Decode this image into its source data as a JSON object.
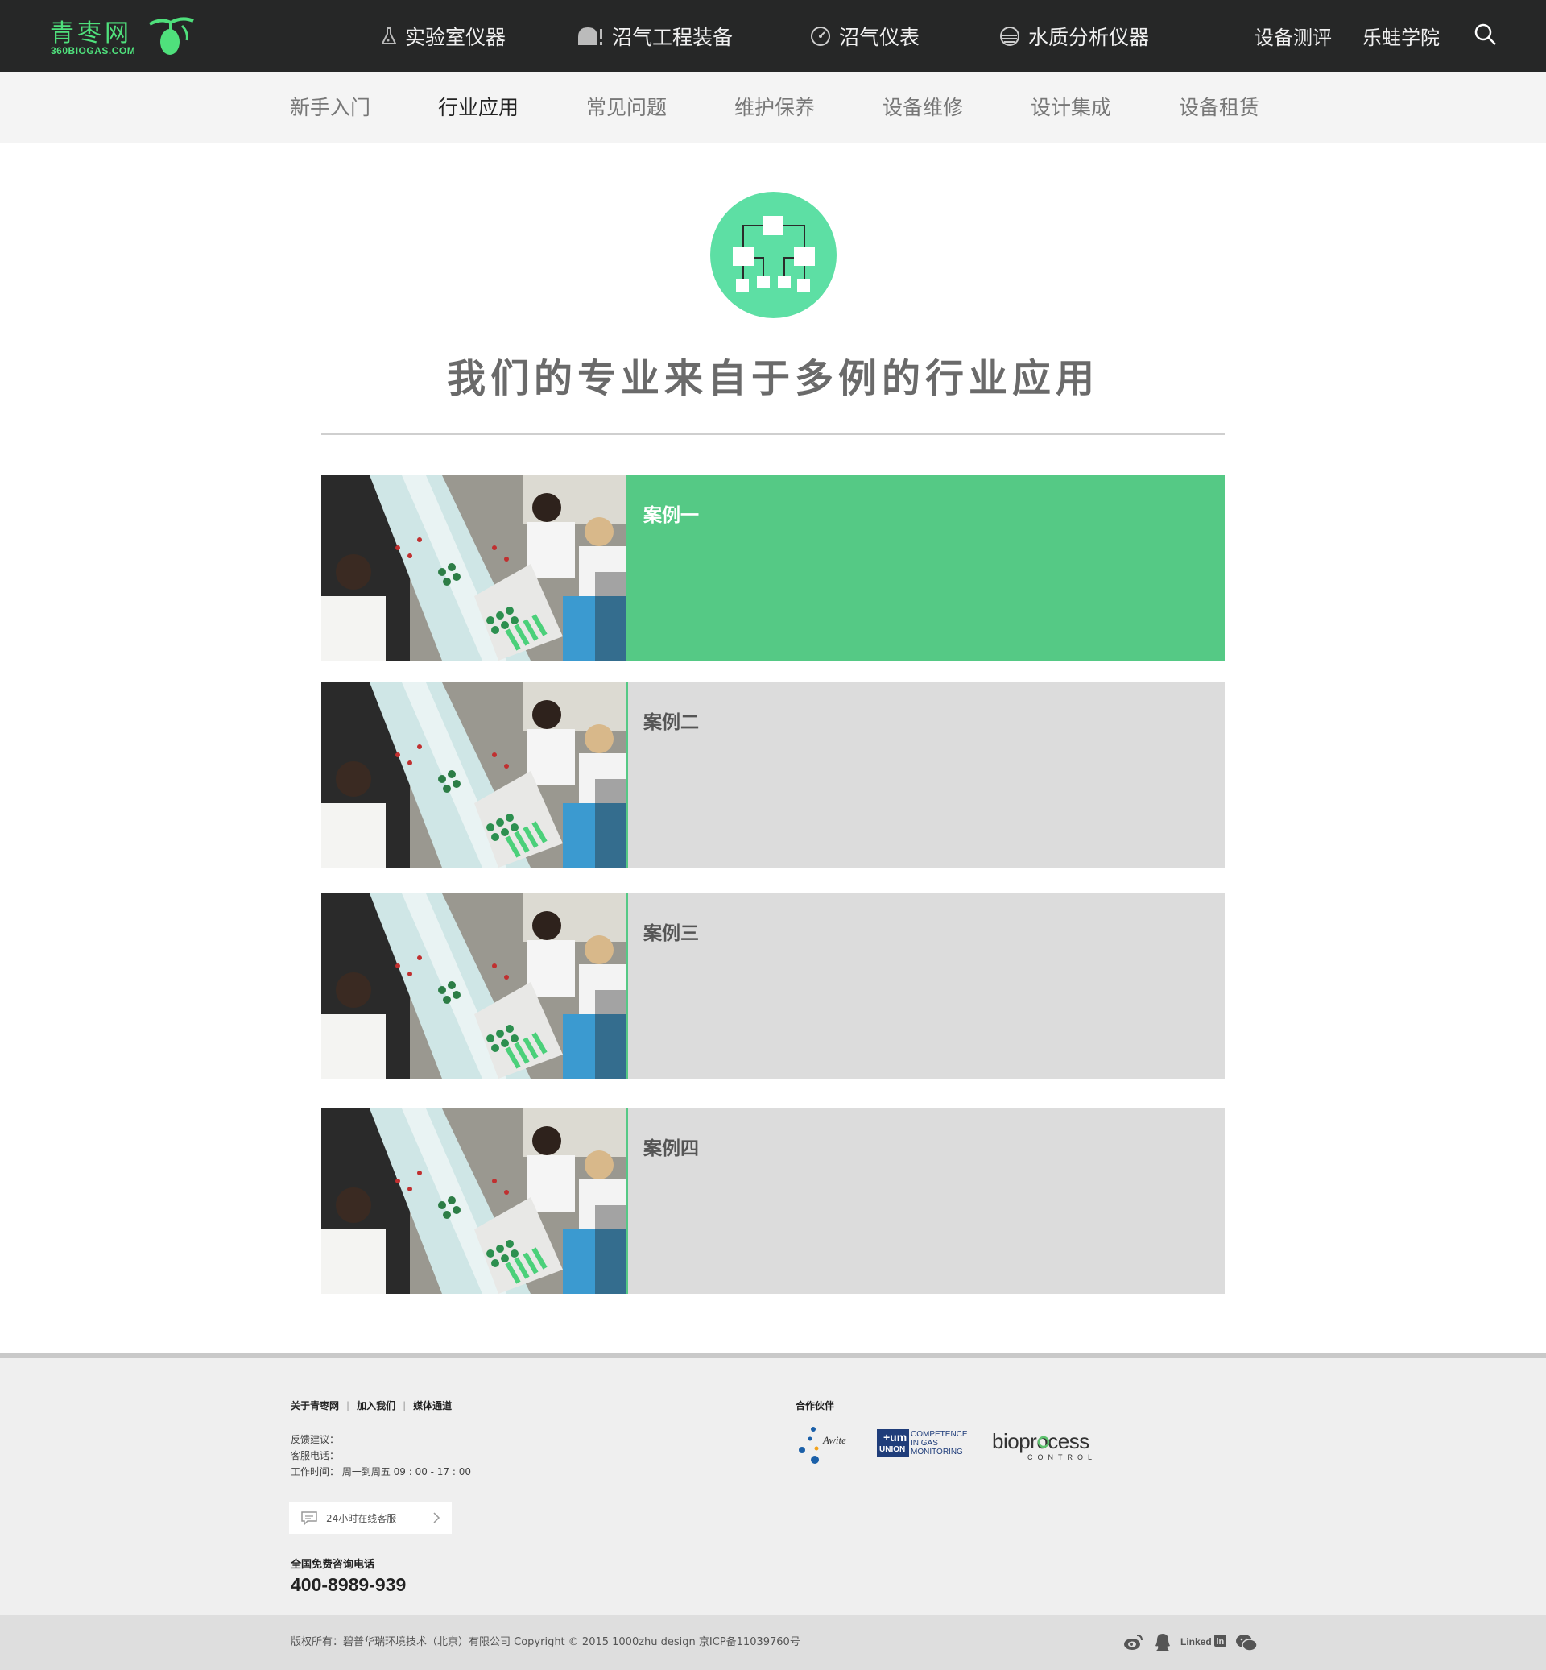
{
  "brand": {
    "name_cn": "青枣网",
    "domain": "360BIOGAS.COM",
    "accent": "#4fe07c"
  },
  "nav": {
    "items": [
      {
        "label": "实验室仪器",
        "icon": "flask-icon"
      },
      {
        "label": "沼气工程装备",
        "icon": "tank-icon"
      },
      {
        "label": "沼气仪表",
        "icon": "gauge-icon"
      },
      {
        "label": "水质分析仪器",
        "icon": "water-icon"
      }
    ],
    "right": [
      {
        "label": "设备测评"
      },
      {
        "label": "乐蛙学院"
      }
    ],
    "search_icon": "search-icon"
  },
  "subnav": {
    "items": [
      {
        "label": "新手入门",
        "active": false
      },
      {
        "label": "行业应用",
        "active": true
      },
      {
        "label": "常见问题",
        "active": false
      },
      {
        "label": "维护保养",
        "active": false
      },
      {
        "label": "设备维修",
        "active": false
      },
      {
        "label": "设计集成",
        "active": false
      },
      {
        "label": "设备租赁",
        "active": false
      }
    ]
  },
  "hero": {
    "icon": "org-chart-icon",
    "title": "我们的专业来自于多例的行业应用",
    "icon_color": "#5ddfa4"
  },
  "cases": [
    {
      "title": "案例一",
      "active": true
    },
    {
      "title": "案例二",
      "active": false
    },
    {
      "title": "案例三",
      "active": false
    },
    {
      "title": "案例四",
      "active": false
    }
  ],
  "footer": {
    "links": [
      "关于青枣网",
      "加入我们",
      "媒体通道"
    ],
    "feedback": "反馈建议：",
    "service_phone": "客服电话：",
    "hours": "工作时间：  周一到周五 09 : 00 - 17 : 00",
    "chat_label": "24小时在线客服",
    "hotline_label": "全国免费咨询电话",
    "hotline": "400-8989-939",
    "partners_label": "合作伙伴",
    "partners": [
      {
        "name": "Awite"
      },
      {
        "name_line1": "COMPETENCE",
        "name_line2": "IN GAS",
        "name_line3": "MONITORING",
        "badge": "UNION"
      },
      {
        "name": "bioprocess",
        "sub": "CONTROL"
      }
    ],
    "copyright": "版权所有：碧普华瑞环境技术（北京）有限公司     Copyright © 2015 1000zhu design 京ICP备11039760号",
    "social": [
      "weibo-icon",
      "qq-icon",
      "linkedin-icon",
      "wechat-icon"
    ],
    "linkedin_text": "Linked"
  }
}
